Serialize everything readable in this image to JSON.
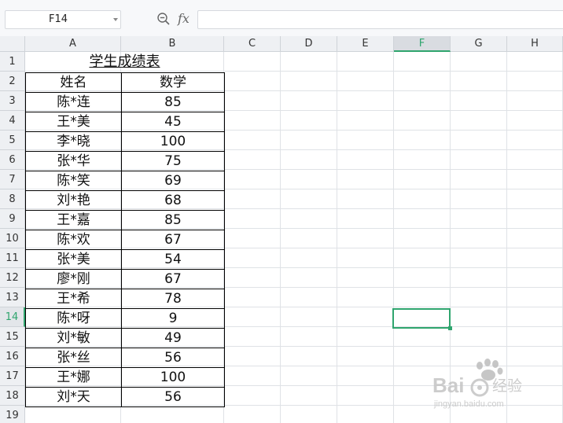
{
  "formula_bar": {
    "name_box": "F14",
    "fx_label": "fx",
    "formula_value": ""
  },
  "columns": [
    "A",
    "B",
    "C",
    "D",
    "E",
    "F",
    "G",
    "H"
  ],
  "selected_column": "F",
  "rows": [
    "1",
    "2",
    "3",
    "4",
    "5",
    "6",
    "7",
    "8",
    "9",
    "10",
    "11",
    "12",
    "13",
    "14",
    "15",
    "16",
    "17",
    "18",
    "19"
  ],
  "selected_row": "14",
  "sheet": {
    "title": "学生成绩表",
    "headers": [
      "姓名",
      "数学"
    ],
    "records": [
      [
        "陈*连",
        "85"
      ],
      [
        "王*美",
        "45"
      ],
      [
        "李*晓",
        "100"
      ],
      [
        "张*华",
        "75"
      ],
      [
        "陈*笑",
        "69"
      ],
      [
        "刘*艳",
        "68"
      ],
      [
        "王*嘉",
        "85"
      ],
      [
        "陈*欢",
        "67"
      ],
      [
        "张*美",
        "54"
      ],
      [
        "廖*刚",
        "67"
      ],
      [
        "王*希",
        "78"
      ],
      [
        "陈*呀",
        "9"
      ],
      [
        "刘*敏",
        "49"
      ],
      [
        "张*丝",
        "56"
      ],
      [
        "王*娜",
        "100"
      ],
      [
        "刘*天",
        "56"
      ]
    ]
  },
  "watermark": {
    "brand": "Bai",
    "brand_suffix": "经验",
    "url": "jingyan.baidu.com"
  },
  "colors": {
    "accent": "#2fa56e",
    "header_bg": "#eef0f3",
    "grid": "#dfe2e6"
  }
}
